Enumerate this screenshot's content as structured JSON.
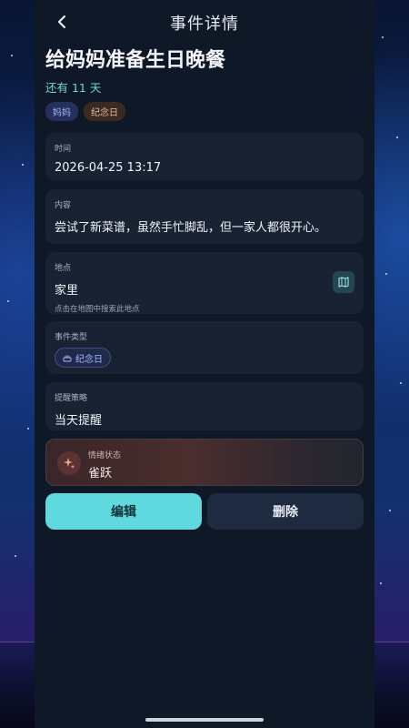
{
  "header": {
    "title": "事件详情"
  },
  "event": {
    "title": "给妈妈准备生日晚餐",
    "countdown": "还有 11 天",
    "tags": [
      "妈妈",
      "纪念日"
    ]
  },
  "time": {
    "label": "时间",
    "value": "2026-04-25 13:17"
  },
  "content": {
    "label": "内容",
    "value": "尝试了新菜谱，虽然手忙脚乱，但一家人都很开心。"
  },
  "location": {
    "label": "地点",
    "value": "家里",
    "hint": "点击在地图中搜索此地点"
  },
  "event_type": {
    "label": "事件类型",
    "value": "纪念日"
  },
  "reminder": {
    "label": "提醒策略",
    "value": "当天提醒"
  },
  "mood": {
    "label": "情绪状态",
    "value": "雀跃"
  },
  "actions": {
    "edit": "编辑",
    "delete": "删除"
  },
  "colors": {
    "accent": "#5fd9de",
    "panel": "#0f1826",
    "card": "#182233"
  },
  "icons": {
    "back": "chevron-left-icon",
    "map": "map-icon",
    "type": "cake-icon",
    "mood": "sparkle-icon"
  }
}
